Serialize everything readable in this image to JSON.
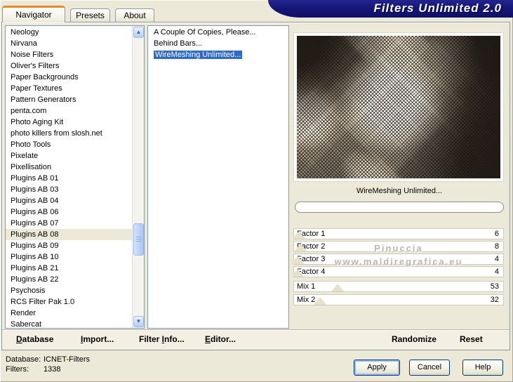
{
  "window": {
    "title": "Filters Unlimited 2.0"
  },
  "tabs": {
    "navigator": "Navigator",
    "presets": "Presets",
    "about": "About"
  },
  "categories": {
    "items": [
      "Neology",
      "Nirvana",
      "Noise Filters",
      "Oliver's Filters",
      "Paper Backgrounds",
      "Paper Textures",
      "Pattern Generators",
      "penta.com",
      "Photo Aging Kit",
      "photo killers from slosh.net",
      "Photo Tools",
      "Pixelate",
      "Pixellisation",
      "Plugins AB 01",
      "Plugins AB 03",
      "Plugins AB 04",
      "Plugins AB 06",
      "Plugins AB 07",
      "Plugins AB 08",
      "Plugins AB 09",
      "Plugins AB 10",
      "Plugins AB 21",
      "Plugins AB 22",
      "Psychosis",
      "RCS Filter Pak 1.0",
      "Render",
      "Sabercat"
    ],
    "selected": "Plugins AB 08",
    "scrollbar": {
      "up_glyph": "▲",
      "down_glyph": "▼"
    }
  },
  "filters": {
    "items": [
      "A Couple Of Copies, Please...",
      "Behind Bars...",
      "WireMeshing Unlimited..."
    ],
    "selected": "WireMeshing Unlimited..."
  },
  "preview": {
    "filter_name": "WireMeshing Unlimited...",
    "progress_percent": 0
  },
  "params": {
    "rows": [
      {
        "label": "Factor 1",
        "value": 6,
        "max": 255
      },
      {
        "label": "Factor 2",
        "value": 8,
        "max": 255
      },
      {
        "label": "Factor 3",
        "value": 4,
        "max": 255
      },
      {
        "label": "Factor 4",
        "value": 4,
        "max": 255
      },
      {
        "label": "Mix 1",
        "value": 53,
        "max": 255
      },
      {
        "label": "Mix 2",
        "value": 32,
        "max": 255
      }
    ]
  },
  "watermark": {
    "line1": "Pinuccia",
    "line2": "www.maldiregrafica.eu"
  },
  "toolbar": {
    "database": {
      "pre": "",
      "key": "D",
      "post": "atabase"
    },
    "import": {
      "pre": "",
      "key": "I",
      "post": "mport..."
    },
    "filter_info": {
      "pre": "Filter ",
      "key": "I",
      "post": "nfo..."
    },
    "editor": {
      "pre": "",
      "key": "E",
      "post": "ditor..."
    },
    "randomize": "Randomize",
    "reset": "Reset"
  },
  "status": {
    "rows": [
      {
        "label": "Database:",
        "value": "ICNET-Filters"
      },
      {
        "label": "Filters:",
        "value": "1338"
      }
    ]
  },
  "action_buttons": {
    "apply": "Apply",
    "cancel": "Cancel",
    "help": "Help"
  },
  "colors": {
    "background": "#ece9d8",
    "banner": "#16167a",
    "selection": "#316ac5",
    "tab_accent": "#e68b2c"
  }
}
